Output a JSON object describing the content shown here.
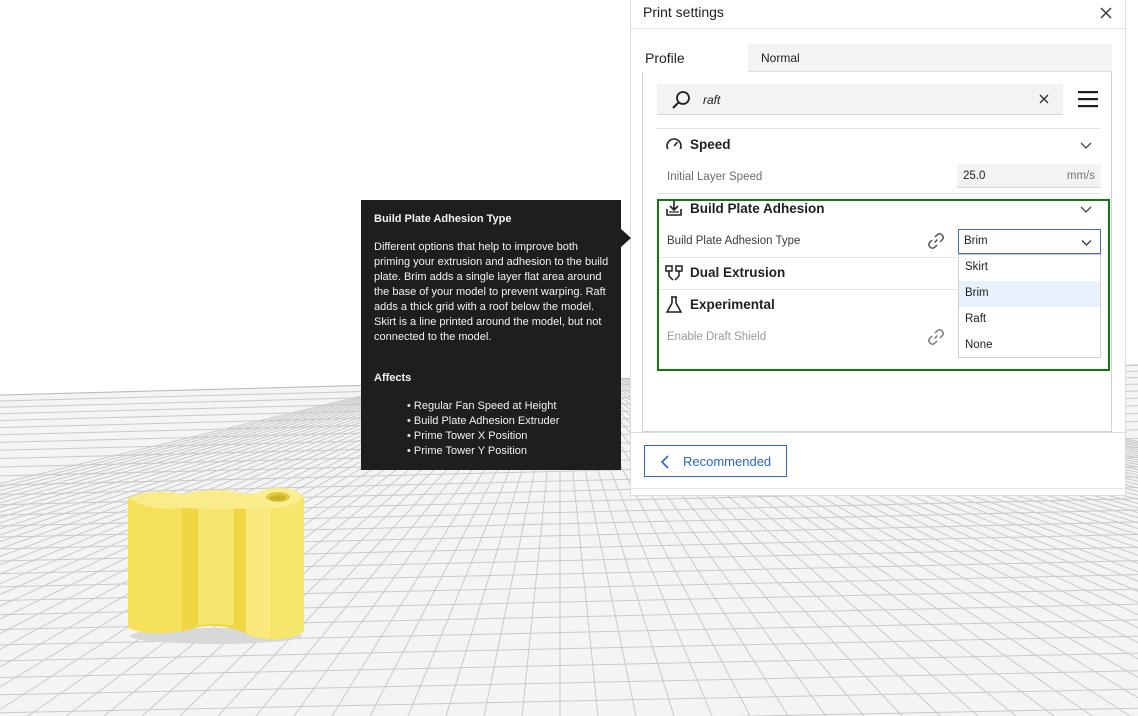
{
  "print_settings": {
    "title": "Print settings",
    "profile_label": "Profile",
    "profile_value": "Normal",
    "search": {
      "value": "raft"
    },
    "categories": {
      "speed": {
        "label": "Speed",
        "settings": [
          {
            "label": "Initial Layer Speed",
            "value": "25.0",
            "unit": "mm/s"
          }
        ]
      },
      "build_plate_adhesion": {
        "label": "Build Plate Adhesion",
        "settings": [
          {
            "label": "Build Plate Adhesion Type",
            "value": "Brim"
          }
        ]
      },
      "dual_extrusion": {
        "label": "Dual Extrusion"
      },
      "experimental": {
        "label": "Experimental",
        "settings": [
          {
            "label": "Enable Draft Shield"
          }
        ]
      }
    },
    "dropdown_options": [
      "Skirt",
      "Brim",
      "Raft",
      "None"
    ],
    "dropdown_selected": "Brim",
    "recommended_label": "Recommended"
  },
  "tooltip": {
    "title": "Build Plate Adhesion Type",
    "body": "Different options that help to improve both priming your extrusion and adhesion to the build plate. Brim adds a single layer flat area around the base of your model to prevent warping. Raft adds a thick grid with a roof below the model. Skirt is a line printed around the model, but not connected to the model.",
    "affects_label": "Affects",
    "affects": [
      "Regular Fan Speed at Height",
      "Build Plate Adhesion Extruder",
      "Prime Tower X Position",
      "Prime Tower Y Position"
    ]
  },
  "colors": {
    "accent": "#2b66c9",
    "highlight": "#0f7a0f",
    "model": "#f7e56a",
    "tooltip_bg": "#1e1e1e"
  },
  "icons": [
    "close-icon",
    "search-icon",
    "clear-icon",
    "menu-icon",
    "speedometer-icon",
    "adhesion-icon",
    "dual-extrusion-icon",
    "flask-icon",
    "chevron-down-icon",
    "link-icon",
    "chevron-left-icon"
  ]
}
